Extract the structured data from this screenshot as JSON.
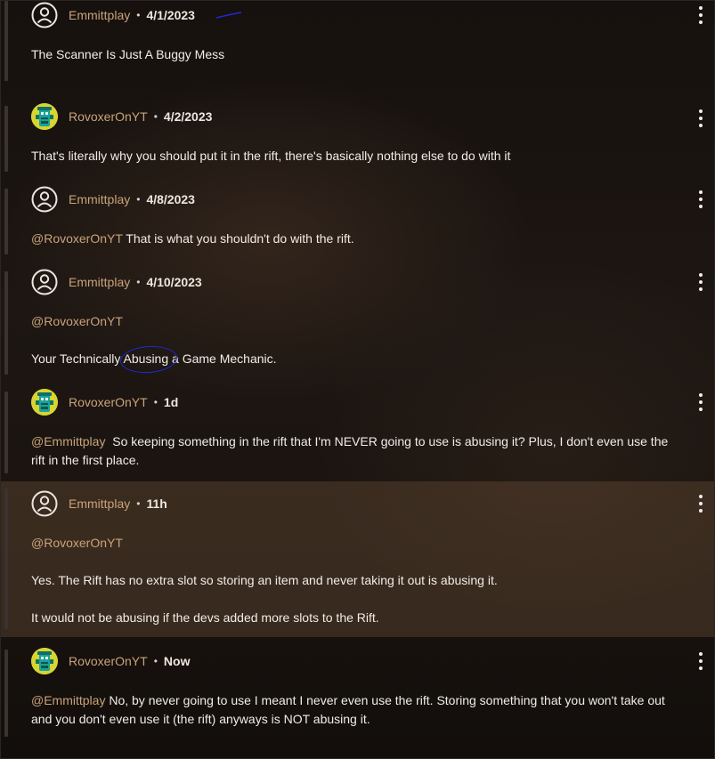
{
  "comments": [
    {
      "author": "Emmittplay",
      "date": "4/1/2023",
      "avatar": "user-outline-icon",
      "lines": [
        {
          "text": "The Scanner Is Just A Buggy Mess"
        }
      ]
    },
    {
      "author": "RovoxerOnYT",
      "date": "4/2/2023",
      "avatar": "tiki-avatar",
      "lines": [
        {
          "text": "That's literally why you should put it in the rift, there's basically nothing else to do with it"
        }
      ]
    },
    {
      "author": "Emmittplay",
      "date": "4/8/2023",
      "avatar": "user-outline-icon",
      "lines": [
        {
          "mention": "@RovoxerOnYT",
          "text": " That is what you shouldn't do with the rift."
        }
      ]
    },
    {
      "author": "Emmittplay",
      "date": "4/10/2023",
      "avatar": "user-outline-icon",
      "lines": [
        {
          "mention": "@RovoxerOnYT",
          "text": ""
        },
        {
          "text_before": "Your Technically ",
          "circled": "Abusing",
          "text_after": " a Game Mechanic."
        }
      ]
    },
    {
      "author": "RovoxerOnYT",
      "date": "1d",
      "avatar": "tiki-avatar",
      "lines": [
        {
          "mention": "@Emmittplay",
          "text": "  So keeping something in the rift that I'm NEVER going to use is abusing it? Plus, I don't even use the"
        },
        {
          "text": "rift in the first place."
        }
      ]
    },
    {
      "author": "Emmittplay",
      "date": "11h",
      "avatar": "user-outline-icon",
      "highlighted": true,
      "lines": [
        {
          "mention": "@RovoxerOnYT",
          "text": ""
        },
        {
          "text": "Yes. The Rift has no extra slot so storing an item and never taking it out is abusing it."
        },
        {
          "text": "It would not be abusing if the devs added more slots to the Rift."
        }
      ]
    },
    {
      "author": "RovoxerOnYT",
      "date": "Now",
      "avatar": "tiki-avatar",
      "lines": [
        {
          "mention": "@Emmittplay",
          "text": " No, by never going to use I meant I never even use the rift. Storing something that you won't take out"
        },
        {
          "text": "and you don't even use it (the rift) anyways is NOT abusing it."
        }
      ]
    }
  ],
  "separator": "•",
  "colors": {
    "author": "#c9a37a",
    "mention": "#c9a37a",
    "highlight_bg": "rgba(110,82,58,0.38)",
    "annotation_pen": "#1e2ad6",
    "avatar_bg": "#d8d430"
  }
}
